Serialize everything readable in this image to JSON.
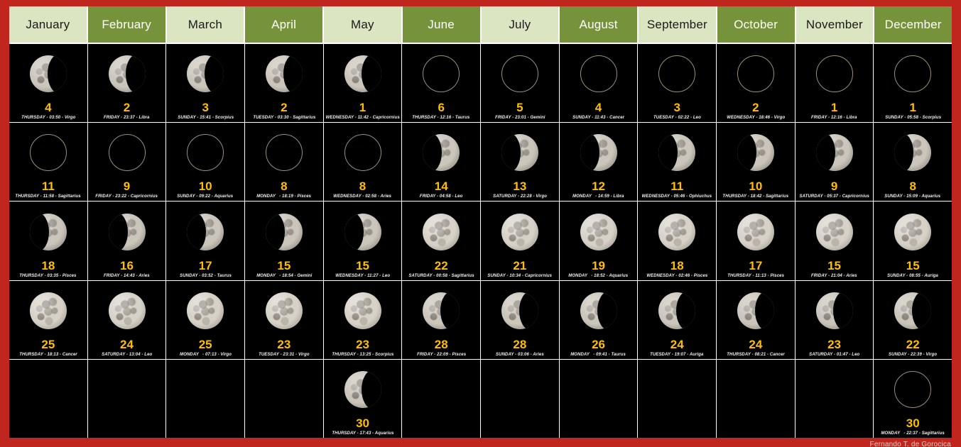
{
  "page": {
    "background_color": "#c0261d",
    "credit": "Fernando T. de Gorocica"
  },
  "header": {
    "colors": {
      "light": "#dbe5c1",
      "dark": "#76933c"
    },
    "months": [
      {
        "label": "January",
        "style": "light"
      },
      {
        "label": "February",
        "style": "dark"
      },
      {
        "label": "March",
        "style": "light"
      },
      {
        "label": "April",
        "style": "dark"
      },
      {
        "label": "May",
        "style": "light"
      },
      {
        "label": "June",
        "style": "dark"
      },
      {
        "label": "July",
        "style": "light"
      },
      {
        "label": "August",
        "style": "dark"
      },
      {
        "label": "September",
        "style": "light"
      },
      {
        "label": "October",
        "style": "dark"
      },
      {
        "label": "November",
        "style": "light"
      },
      {
        "label": "December",
        "style": "dark"
      }
    ]
  },
  "day_number_color": "#ffbf00",
  "columns": [
    {
      "month": "January",
      "cells": [
        {
          "phase": "last-quarter",
          "day": "4",
          "caption": "THURSDAY - 03:50 - Virgo"
        },
        {
          "phase": "new",
          "day": "11",
          "caption": "THURSDAY - 11:58 - Sagittarius"
        },
        {
          "phase": "first-quarter",
          "day": "18",
          "caption": "THURSDAY - 03:35 - Pisces"
        },
        {
          "phase": "full",
          "day": "25",
          "caption": "THURSDAY - 18:13 - Cancer"
        },
        {
          "phase": "none",
          "day": "",
          "caption": ""
        }
      ]
    },
    {
      "month": "February",
      "cells": [
        {
          "phase": "last-quarter",
          "day": "2",
          "caption": "FRIDAY - 23:37 - Libra"
        },
        {
          "phase": "new",
          "day": "9",
          "caption": "FRIDAY - 23:22 - Capricornius"
        },
        {
          "phase": "first-quarter",
          "day": "16",
          "caption": "FRIDAY - 14:43 - Aries"
        },
        {
          "phase": "full",
          "day": "24",
          "caption": "SATURDAY - 13:04 - Leo"
        },
        {
          "phase": "none",
          "day": "",
          "caption": ""
        }
      ]
    },
    {
      "month": "March",
      "cells": [
        {
          "phase": "last-quarter",
          "day": "3",
          "caption": "SUNDAY - 15:41 - Scorpius"
        },
        {
          "phase": "new",
          "day": "10",
          "caption": "SUNDAY - 09:22 - Aquarius"
        },
        {
          "phase": "first-quarter",
          "day": "17",
          "caption": "SUNDAY - 03:52 - Taurus"
        },
        {
          "phase": "full",
          "day": "25",
          "caption": "MONDAY   - 07:13 - Virgo"
        },
        {
          "phase": "none",
          "day": "",
          "caption": ""
        }
      ]
    },
    {
      "month": "April",
      "cells": [
        {
          "phase": "last-quarter",
          "day": "2",
          "caption": "TUESDAY - 03:30 - Sagittarius"
        },
        {
          "phase": "new",
          "day": "8",
          "caption": "MONDAY   - 18:19 - Pisces"
        },
        {
          "phase": "first-quarter",
          "day": "15",
          "caption": "MONDAY   - 18:54 - Gemini"
        },
        {
          "phase": "full",
          "day": "23",
          "caption": "TUESDAY - 23:31 - Virgo"
        },
        {
          "phase": "none",
          "day": "",
          "caption": ""
        }
      ]
    },
    {
      "month": "May",
      "cells": [
        {
          "phase": "last-quarter",
          "day": "1",
          "caption": "WEDNESDAY - 11:42 - Capricornius"
        },
        {
          "phase": "new",
          "day": "8",
          "caption": "WEDNESDAY - 02:58 - Aries"
        },
        {
          "phase": "first-quarter",
          "day": "15",
          "caption": "WEDNESDAY - 11:27 - Leo"
        },
        {
          "phase": "full",
          "day": "23",
          "caption": "THURSDAY - 13:25 - Scorpius"
        },
        {
          "phase": "last-quarter",
          "day": "30",
          "caption": "THURSDAY - 17:43 - Aquarius"
        }
      ]
    },
    {
      "month": "June",
      "cells": [
        {
          "phase": "new",
          "day": "6",
          "caption": "THURSDAY - 12:16 - Taurus"
        },
        {
          "phase": "first-quarter",
          "day": "14",
          "caption": "FRIDAY - 04:58 - Leo"
        },
        {
          "phase": "full",
          "day": "22",
          "caption": "SATURDAY - 00:58 - Sagittarius"
        },
        {
          "phase": "last-quarter",
          "day": "28",
          "caption": "FRIDAY - 22:09 - Pisces"
        },
        {
          "phase": "none",
          "day": "",
          "caption": ""
        }
      ]
    },
    {
      "month": "July",
      "cells": [
        {
          "phase": "new",
          "day": "5",
          "caption": "FRIDAY - 23:01 - Gemini"
        },
        {
          "phase": "first-quarter",
          "day": "13",
          "caption": "SATURDAY - 22:28 - Virgo"
        },
        {
          "phase": "full",
          "day": "21",
          "caption": "SUNDAY - 10:34 - Capricornius"
        },
        {
          "phase": "last-quarter",
          "day": "28",
          "caption": "SUNDAY - 03:06 - Aries"
        },
        {
          "phase": "none",
          "day": "",
          "caption": ""
        }
      ]
    },
    {
      "month": "August",
      "cells": [
        {
          "phase": "new",
          "day": "4",
          "caption": "SUNDAY - 11:43 - Cancer"
        },
        {
          "phase": "first-quarter",
          "day": "12",
          "caption": "MONDAY   - 14:59 - Libra"
        },
        {
          "phase": "full",
          "day": "19",
          "caption": "MONDAY   - 18:52 - Aquarius"
        },
        {
          "phase": "last-quarter",
          "day": "26",
          "caption": "MONDAY   - 09:41 - Taurus"
        },
        {
          "phase": "none",
          "day": "",
          "caption": ""
        }
      ]
    },
    {
      "month": "September",
      "cells": [
        {
          "phase": "new",
          "day": "3",
          "caption": "TUESDAY - 02:22 - Leo"
        },
        {
          "phase": "first-quarter",
          "day": "11",
          "caption": "WEDNESDAY - 05:46 - Ophiuchus"
        },
        {
          "phase": "full",
          "day": "18",
          "caption": "WEDNESDAY - 02:46 - Pisces"
        },
        {
          "phase": "last-quarter",
          "day": "24",
          "caption": "TUESDAY - 19:07 - Auriga"
        },
        {
          "phase": "none",
          "day": "",
          "caption": ""
        }
      ]
    },
    {
      "month": "October",
      "cells": [
        {
          "phase": "new",
          "day": "2",
          "caption": "WEDNESDAY - 18:46 - Virgo"
        },
        {
          "phase": "first-quarter",
          "day": "10",
          "caption": "THURSDAY - 18:42 - Sagittarius"
        },
        {
          "phase": "full",
          "day": "17",
          "caption": "THURSDAY - 11:13 - Pisces"
        },
        {
          "phase": "last-quarter",
          "day": "24",
          "caption": "THURSDAY - 08:21 - Cancer"
        },
        {
          "phase": "none",
          "day": "",
          "caption": ""
        }
      ]
    },
    {
      "month": "November",
      "cells": [
        {
          "phase": "new",
          "day": "1",
          "caption": "FRIDAY - 12:16 - Libra"
        },
        {
          "phase": "first-quarter",
          "day": "9",
          "caption": "SATURDAY - 05:37 - Capricornius"
        },
        {
          "phase": "full",
          "day": "15",
          "caption": "FRIDAY - 21:04 - Aries"
        },
        {
          "phase": "last-quarter",
          "day": "23",
          "caption": "SATURDAY - 01:47 - Leo"
        },
        {
          "phase": "none",
          "day": "",
          "caption": ""
        }
      ]
    },
    {
      "month": "December",
      "cells": [
        {
          "phase": "new",
          "day": "1",
          "caption": "SUNDAY - 05:58 - Scorpius"
        },
        {
          "phase": "first-quarter",
          "day": "8",
          "caption": "SUNDAY - 15:09 - Aquarius"
        },
        {
          "phase": "full",
          "day": "15",
          "caption": "SUNDAY - 08:55 - Auriga"
        },
        {
          "phase": "last-quarter",
          "day": "22",
          "caption": "SUNDAY - 22:39 - Virgo"
        },
        {
          "phase": "new",
          "day": "30",
          "caption": "MONDAY   - 22:37 - Sagittarius"
        }
      ]
    }
  ]
}
